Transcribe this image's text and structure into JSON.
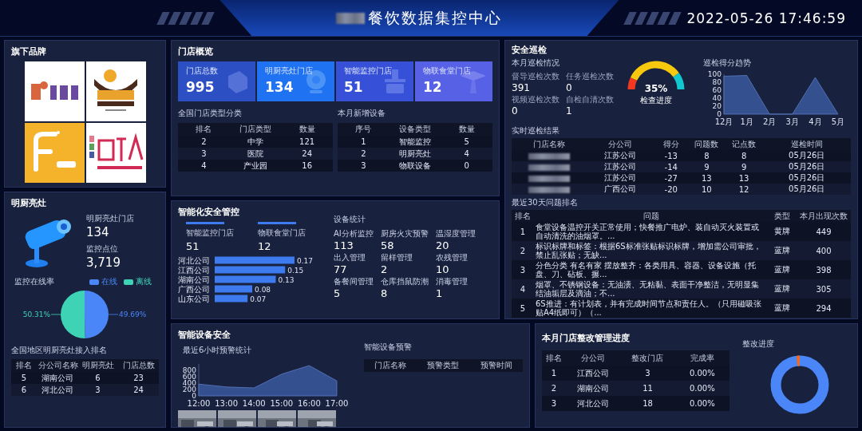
{
  "header": {
    "title": "餐饮数据集控中心",
    "datetime": "2022-05-26 17:46:59"
  },
  "brands": {
    "title": "旗下品牌"
  },
  "kitchen": {
    "title": "明厨亮灶",
    "stats": [
      {
        "label": "明厨亮灶门店",
        "value": "134"
      },
      {
        "label": "监控点位",
        "value": "3,719"
      }
    ],
    "online_rate": {
      "title": "监控在线率",
      "legend": [
        {
          "color": "#4a86f7"
        },
        {
          "color": "#3fd3b6"
        }
      ],
      "chart_data": {
        "type": "pie",
        "categories": [
          "在线",
          "离线"
        ],
        "values": [
          49.69,
          50.31
        ],
        "value_labels": [
          "49.69%",
          "50.31%"
        ]
      }
    },
    "ranking": {
      "title": "全国地区明厨亮灶接入排名",
      "columns": [
        "排名",
        "分公司名称",
        "明厨亮灶",
        "门店总数"
      ],
      "rows": [
        [
          "5",
          "湖南公司",
          "6",
          "23"
        ],
        [
          "6",
          "河北公司",
          "3",
          "24"
        ]
      ]
    }
  },
  "stores": {
    "title": "门店概览",
    "kpis": [
      {
        "label": "门店总数",
        "value": "995",
        "color": "#2c4fc4",
        "kind": "cube"
      },
      {
        "label": "明厨亮灶门店",
        "value": "134",
        "color": "#1f72f2",
        "kind": "webcam"
      },
      {
        "label": "智能监控门店",
        "value": "51",
        "color": "#3651d8",
        "kind": "device"
      },
      {
        "label": "物联食堂门店",
        "value": "12",
        "color": "#5661e6",
        "kind": "box"
      }
    ],
    "type_table": {
      "title": "全国门店类型分类",
      "columns": [
        "排名",
        "门店类型",
        "数量"
      ],
      "rows": [
        [
          "2",
          "中学",
          "121"
        ],
        [
          "3",
          "医院",
          "24"
        ],
        [
          "4",
          "产业园",
          "16"
        ]
      ]
    },
    "device_table": {
      "title": "本月新增设备",
      "columns": [
        "序号",
        "设备类型",
        "数量"
      ],
      "rows": [
        [
          "1",
          "智能监控",
          "5"
        ],
        [
          "2",
          "明厨亮灶",
          "4"
        ],
        [
          "3",
          "物联设备",
          "0"
        ]
      ]
    }
  },
  "safety_ctrl": {
    "title": "智能化安全管控",
    "stats": [
      {
        "label": "智能监控门店",
        "value": "51"
      },
      {
        "label": "物联食堂门店",
        "value": "12"
      }
    ],
    "chart_data": {
      "type": "bar",
      "orientation": "horizontal",
      "categories": [
        "河北公司",
        "江西公司",
        "湖南公司",
        "广西公司",
        "山东公司"
      ],
      "values": [
        0.17,
        0.15,
        0.13,
        0.08,
        0.07
      ],
      "data_labels": true
    },
    "device_stats": {
      "title": "设备统计",
      "items": [
        {
          "label": "AI分析监控",
          "value": "113"
        },
        {
          "label": "厨房火灾预警",
          "value": "58"
        },
        {
          "label": "温湿度管理",
          "value": "20"
        },
        {
          "label": "出入管理",
          "value": "77"
        },
        {
          "label": "留样管理",
          "value": "2"
        },
        {
          "label": "农残管理",
          "value": "10"
        },
        {
          "label": "备餐间管理",
          "value": "5"
        },
        {
          "label": "仓库挡鼠防潮",
          "value": "8"
        },
        {
          "label": "消毒管理",
          "value": "1"
        }
      ]
    }
  },
  "patrol": {
    "title": "安全巡检",
    "month_title": "本月巡检情况",
    "stats": [
      {
        "label": "督导巡检次数",
        "value": "391"
      },
      {
        "label": "任务巡检次数",
        "value": "0"
      },
      {
        "label": "视频巡检次数",
        "value": "0"
      },
      {
        "label": "自检自清次数",
        "value": "1"
      }
    ],
    "gauge": {
      "value": "35%",
      "label": "检查进度"
    },
    "trend": {
      "title": "巡检得分趋势",
      "chart_data": {
        "type": "area",
        "x": [
          "12月",
          "1月",
          "2月",
          "3月",
          "4月",
          "5月"
        ],
        "values": [
          95,
          97,
          0,
          0,
          92,
          0
        ],
        "ylim": [
          0,
          100
        ],
        "yticks": [
          0,
          20,
          40,
          60,
          80,
          100
        ]
      }
    },
    "results": {
      "title": "实时巡检结果",
      "columns": [
        "门店名称",
        "分公司",
        "得分",
        "问题数",
        "记点数",
        "巡检时间"
      ],
      "rows": [
        [
          "",
          "江苏公司",
          "-13",
          "8",
          "8",
          "05月26日"
        ],
        [
          "",
          "江苏公司",
          "-14",
          "9",
          "9",
          "05月26日"
        ],
        [
          "",
          "江苏公司",
          "-27",
          "13",
          "13",
          "05月26日"
        ],
        [
          "",
          "广西公司",
          "-20",
          "10",
          "12",
          "05月26日"
        ]
      ]
    },
    "issues": {
      "title": "最近30天问题排名",
      "columns": [
        "排名",
        "问题",
        "类型",
        "本月出现次数"
      ],
      "rows": [
        [
          "1",
          "食堂设备温控开关正常使用；快餐推广电炉、装自动灭火装置或自动清洗的油烟罩。...",
          "黄牌",
          "449"
        ],
        [
          "2",
          "标识标牌和标签：根据6S标准张贴标识标牌，增加需公司审批，禁止乱张贴；无缺...",
          "蓝牌",
          "400"
        ],
        [
          "3",
          "分色分类 有名有家 摆放整齐：各类用具、容器、设备设施（托盘、刀、砧板、搌...",
          "蓝牌",
          "398"
        ],
        [
          "4",
          "烟罩、不锈钢设备：无油渍、无粘黏、表面干净整洁，无明显集结油垢层及滴油；不...",
          "蓝牌",
          "305"
        ],
        [
          "5",
          "6S推进：有计划表，并有完成时间节点和责任人。（只用磁吸张贴A4纸即可）（...",
          "蓝牌",
          "294"
        ]
      ]
    }
  },
  "device_safety": {
    "title": "智能设备安全",
    "trend": {
      "title": "最近6小时预警统计",
      "chart_data": {
        "type": "area",
        "x": [
          "12:00",
          "13:00",
          "14:00",
          "15:00",
          "16:00",
          "17:00"
        ],
        "values": [
          370,
          280,
          250,
          680,
          950,
          470
        ],
        "ylim": [
          0,
          1000
        ],
        "yticks": [
          0,
          200,
          400,
          600,
          800
        ]
      }
    },
    "warnings": {
      "title": "智能设备预警",
      "columns": [
        "门店名称",
        "预警类型",
        "预警时间"
      ]
    }
  },
  "rectify": {
    "title": "本月门店整改管理进度",
    "table": {
      "columns": [
        "排名",
        "分公司",
        "整改门店",
        "完成率"
      ],
      "rows": [
        [
          "1",
          "江西公司",
          "3",
          "0.00%"
        ],
        [
          "2",
          "湖南公司",
          "11",
          "0.00%"
        ],
        [
          "3",
          "河北公司",
          "18",
          "0.00%"
        ]
      ]
    },
    "progress": {
      "title": "整改进度"
    }
  }
}
